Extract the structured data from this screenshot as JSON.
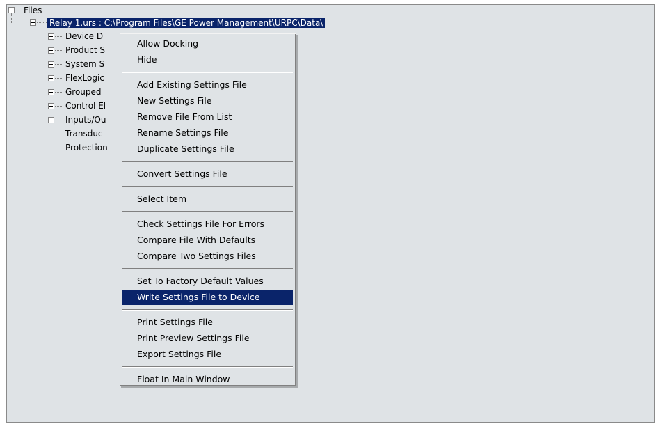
{
  "tree": {
    "root": {
      "label": "Files",
      "expanded": true
    },
    "relay": {
      "label": "Relay 1.urs : C:\\Program Files\\GE Power Management\\URPC\\Data\\",
      "expanded": true,
      "selected": true
    },
    "children": [
      {
        "label": "Device D",
        "expandable": true
      },
      {
        "label": "Product S",
        "expandable": true
      },
      {
        "label": "System S",
        "expandable": true
      },
      {
        "label": "FlexLogic",
        "expandable": true
      },
      {
        "label": "Grouped",
        "expandable": true
      },
      {
        "label": "Control El",
        "expandable": true
      },
      {
        "label": "Inputs/Ou",
        "expandable": true
      },
      {
        "label": "Transduc",
        "expandable": false
      },
      {
        "label": "Protection",
        "expandable": false
      }
    ]
  },
  "context_menu": {
    "groups": [
      [
        "Allow Docking",
        "Hide"
      ],
      [
        "Add Existing Settings File",
        "New Settings File",
        "Remove File From List",
        "Rename Settings File",
        "Duplicate Settings File"
      ],
      [
        "Convert Settings File"
      ],
      [
        "Select Item"
      ],
      [
        "Check Settings File For Errors",
        "Compare File With Defaults",
        "Compare Two Settings Files"
      ],
      [
        "Set To Factory Default Values",
        "Write Settings File to Device"
      ],
      [
        "Print Settings File",
        "Print Preview Settings File",
        "Export Settings File"
      ],
      [
        "Float In Main Window"
      ]
    ],
    "highlighted": "Write Settings File to Device"
  },
  "colors": {
    "pane_bg": "#dfe3e6",
    "selection": "#0a246a"
  }
}
